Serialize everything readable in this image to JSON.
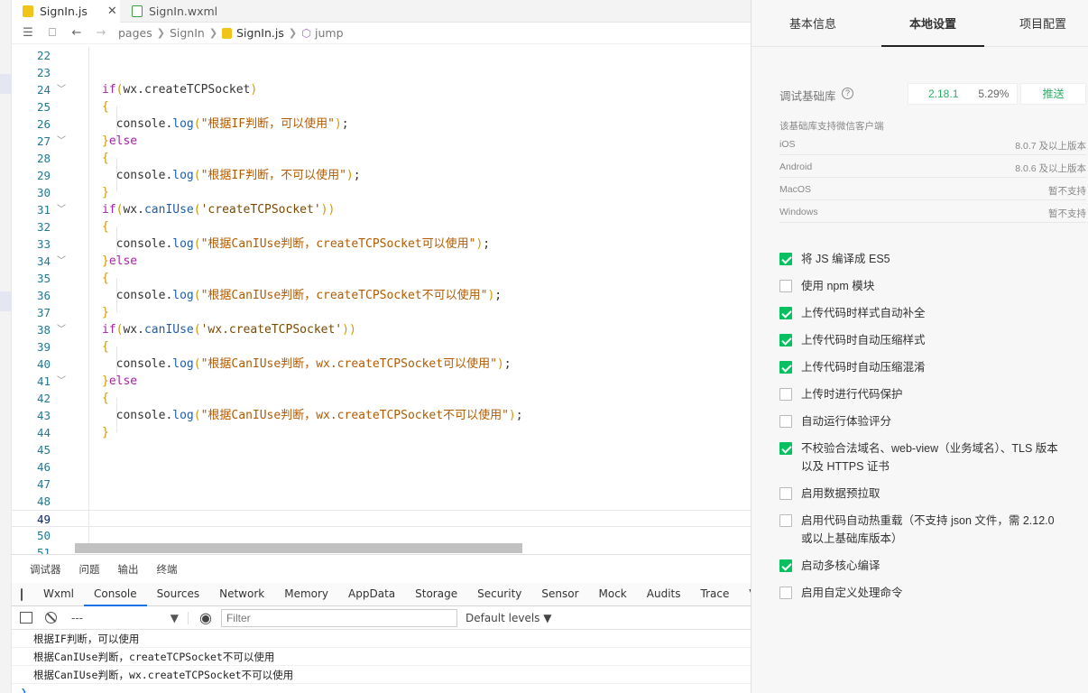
{
  "editor": {
    "tabs": [
      {
        "label": "SignIn.js",
        "close": "✕"
      },
      {
        "label": "SignIn.wxml"
      }
    ],
    "breadcrumb": [
      "pages",
      "SignIn",
      "SignIn.js",
      "jump"
    ],
    "lines": [
      {
        "n": "22"
      },
      {
        "n": "23"
      },
      {
        "n": "24"
      },
      {
        "n": "25"
      },
      {
        "n": "26"
      },
      {
        "n": "27"
      },
      {
        "n": "28"
      },
      {
        "n": "29"
      },
      {
        "n": "30"
      },
      {
        "n": "31"
      },
      {
        "n": "32"
      },
      {
        "n": "33"
      },
      {
        "n": "34"
      },
      {
        "n": "35"
      },
      {
        "n": "36"
      },
      {
        "n": "37"
      },
      {
        "n": "38"
      },
      {
        "n": "39"
      },
      {
        "n": "40"
      },
      {
        "n": "41"
      },
      {
        "n": "42"
      },
      {
        "n": "43"
      },
      {
        "n": "44"
      },
      {
        "n": "45"
      },
      {
        "n": "46"
      },
      {
        "n": "47"
      },
      {
        "n": "48"
      },
      {
        "n": "49"
      },
      {
        "n": "50"
      },
      {
        "n": "51"
      }
    ],
    "code": {
      "if1": "wx.createTCPSocket",
      "log1": "\"根据IF判断，可以使用\"",
      "log2": "\"根据IF判断，不可以使用\"",
      "if2": "'createTCPSocket'",
      "log3": "\"根据CanIUse判断，createTCPSocket可以使用\"",
      "log4": "\"根据CanIUse判断，createTCPSocket不可以使用\"",
      "if3": "'wx.createTCPSocket'",
      "log5": "\"根据CanIUse判断，wx.createTCPSocket可以使用\"",
      "log6": "\"根据CanIUse判断，wx.createTCPSocket不可以使用\""
    }
  },
  "devtools": {
    "tabs": [
      "调试器",
      "问题",
      "输出",
      "终端"
    ],
    "panels": [
      "Wxml",
      "Console",
      "Sources",
      "Network",
      "Memory",
      "AppData",
      "Storage",
      "Security",
      "Sensor",
      "Mock",
      "Audits",
      "Trace",
      "Vu"
    ],
    "context": "---",
    "filter_placeholder": "Filter",
    "levels": "Default levels ▼",
    "logs": [
      "根据IF判断，可以使用",
      "根据CanIUse判断，createTCPSocket不可以使用",
      "根据CanIUse判断，wx.createTCPSocket不可以使用"
    ]
  },
  "settings": {
    "tabs": [
      "基本信息",
      "本地设置",
      "项目配置"
    ],
    "active_tab": "本地设置",
    "lib_label": "调试基础库",
    "lib_version": "2.18.1",
    "lib_percent": "5.29%",
    "push": "推送",
    "support_title": "该基础库支持微信客户端",
    "platforms": [
      {
        "name": "iOS",
        "value": "8.0.7 及以上版本"
      },
      {
        "name": "Android",
        "value": "8.0.6 及以上版本"
      },
      {
        "name": "MacOS",
        "value": "暂不支持"
      },
      {
        "name": "Windows",
        "value": "暂不支持"
      }
    ],
    "options": [
      {
        "label": "将 JS 编译成 ES5",
        "checked": true
      },
      {
        "label": "使用 npm 模块",
        "checked": false
      },
      {
        "label": "上传代码时样式自动补全",
        "checked": true
      },
      {
        "label": "上传代码时自动压缩样式",
        "checked": true
      },
      {
        "label": "上传代码时自动压缩混淆",
        "checked": true
      },
      {
        "label": "上传时进行代码保护",
        "checked": false
      },
      {
        "label": "自动运行体验评分",
        "checked": false
      },
      {
        "label": "不校验合法域名、web-view（业务域名）、TLS 版本以及 HTTPS 证书",
        "checked": true
      },
      {
        "label": "启用数据预拉取",
        "checked": false
      },
      {
        "label": "启用代码自动热重载（不支持 json 文件，需 2.12.0 或以上基础库版本）",
        "checked": false
      },
      {
        "label": "启动多核心编译",
        "checked": true
      },
      {
        "label": "启用自定义处理命令",
        "checked": false
      }
    ]
  }
}
